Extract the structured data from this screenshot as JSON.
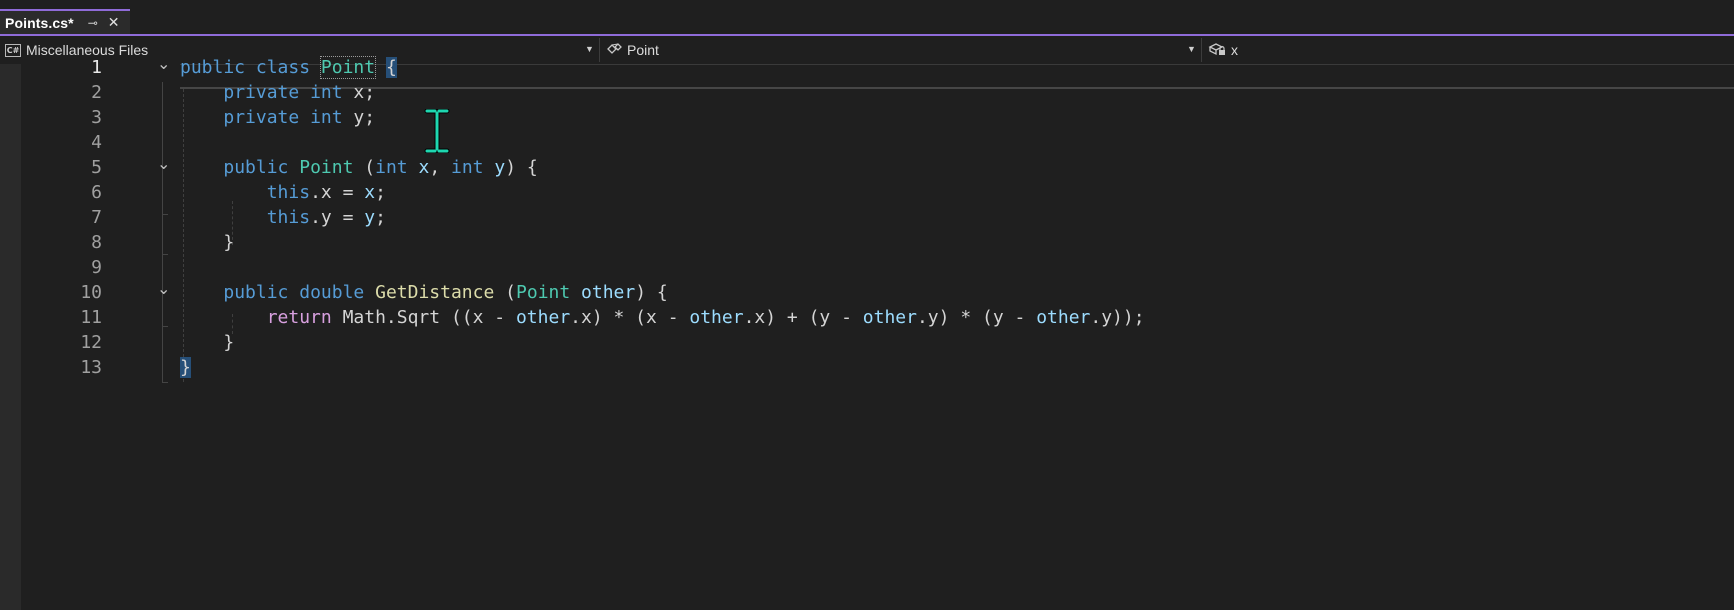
{
  "tab": {
    "title": "Points.cs*",
    "pin_glyph": "⊸",
    "close_glyph": "✕"
  },
  "navbar": {
    "project": {
      "badge": "C#",
      "label": "Miscellaneous Files"
    },
    "type": {
      "label": "Point"
    },
    "member": {
      "label": "x"
    }
  },
  "editor": {
    "line_numbers": [
      "1",
      "2",
      "3",
      "4",
      "5",
      "6",
      "7",
      "8",
      "9",
      "10",
      "11",
      "12",
      "13"
    ],
    "current_line": 1,
    "lines": [
      [
        {
          "t": "public",
          "c": "kw"
        },
        {
          "t": " ",
          "c": "pl"
        },
        {
          "t": "class",
          "c": "kw"
        },
        {
          "t": " ",
          "c": "pl"
        },
        {
          "t": "Point",
          "c": "ty",
          "box": true
        },
        {
          "t": " ",
          "c": "pl"
        },
        {
          "t": "{",
          "c": "pl",
          "hl": true
        }
      ],
      [
        {
          "t": "    ",
          "c": "pl"
        },
        {
          "t": "private",
          "c": "kw"
        },
        {
          "t": " ",
          "c": "pl"
        },
        {
          "t": "int",
          "c": "kw"
        },
        {
          "t": " x;",
          "c": "pl"
        }
      ],
      [
        {
          "t": "    ",
          "c": "pl"
        },
        {
          "t": "private",
          "c": "kw"
        },
        {
          "t": " ",
          "c": "pl"
        },
        {
          "t": "int",
          "c": "kw"
        },
        {
          "t": " y;",
          "c": "pl"
        }
      ],
      [],
      [
        {
          "t": "    ",
          "c": "pl"
        },
        {
          "t": "public",
          "c": "kw"
        },
        {
          "t": " ",
          "c": "pl"
        },
        {
          "t": "Point",
          "c": "ty"
        },
        {
          "t": " (",
          "c": "pl"
        },
        {
          "t": "int",
          "c": "kw"
        },
        {
          "t": " ",
          "c": "pl"
        },
        {
          "t": "x",
          "c": "pa"
        },
        {
          "t": ", ",
          "c": "pl"
        },
        {
          "t": "int",
          "c": "kw"
        },
        {
          "t": " ",
          "c": "pl"
        },
        {
          "t": "y",
          "c": "pa"
        },
        {
          "t": ") {",
          "c": "pl"
        }
      ],
      [
        {
          "t": "        ",
          "c": "pl"
        },
        {
          "t": "this",
          "c": "kw"
        },
        {
          "t": ".x = ",
          "c": "pl"
        },
        {
          "t": "x",
          "c": "pa"
        },
        {
          "t": ";",
          "c": "pl"
        }
      ],
      [
        {
          "t": "        ",
          "c": "pl"
        },
        {
          "t": "this",
          "c": "kw"
        },
        {
          "t": ".y = ",
          "c": "pl"
        },
        {
          "t": "y",
          "c": "pa"
        },
        {
          "t": ";",
          "c": "pl"
        }
      ],
      [
        {
          "t": "    }",
          "c": "pl"
        }
      ],
      [],
      [
        {
          "t": "    ",
          "c": "pl"
        },
        {
          "t": "public",
          "c": "kw"
        },
        {
          "t": " ",
          "c": "pl"
        },
        {
          "t": "double",
          "c": "kw"
        },
        {
          "t": " ",
          "c": "pl"
        },
        {
          "t": "GetDistance",
          "c": "fn"
        },
        {
          "t": " (",
          "c": "pl"
        },
        {
          "t": "Point",
          "c": "ty"
        },
        {
          "t": " ",
          "c": "pl"
        },
        {
          "t": "other",
          "c": "pa"
        },
        {
          "t": ") {",
          "c": "pl"
        }
      ],
      [
        {
          "t": "        ",
          "c": "pl"
        },
        {
          "t": "return",
          "c": "kw2"
        },
        {
          "t": " Math.Sqrt ((x - ",
          "c": "pl"
        },
        {
          "t": "other",
          "c": "pa"
        },
        {
          "t": ".x) * (x - ",
          "c": "pl"
        },
        {
          "t": "other",
          "c": "pa"
        },
        {
          "t": ".x) + (y - ",
          "c": "pl"
        },
        {
          "t": "other",
          "c": "pa"
        },
        {
          "t": ".y) * (y - ",
          "c": "pl"
        },
        {
          "t": "other",
          "c": "pa"
        },
        {
          "t": ".y));",
          "c": "pl"
        }
      ],
      [
        {
          "t": "    }",
          "c": "pl"
        }
      ],
      [
        {
          "t": "}",
          "c": "pl",
          "hl": true
        }
      ]
    ],
    "fold_lines": [
      1,
      5,
      10
    ]
  },
  "colors": {
    "accent": "#8f6bd8",
    "background": "#1f1f1f",
    "keyword": "#569cd6",
    "control_keyword": "#d8a0df",
    "type": "#4ec9b0",
    "method": "#dcdcaa",
    "parameter": "#9cdcfe",
    "plain": "#d4d4d4",
    "brace_highlight": "#264f78",
    "cursor": "#1ed7b0"
  },
  "icons": {
    "project": "csharp-file-icon",
    "type": "class-icon",
    "member": "field-lock-icon",
    "dropdown": "chevron-down-icon",
    "fold": "collapse-chevron-icon",
    "cursor": "i-beam-cursor-icon"
  }
}
